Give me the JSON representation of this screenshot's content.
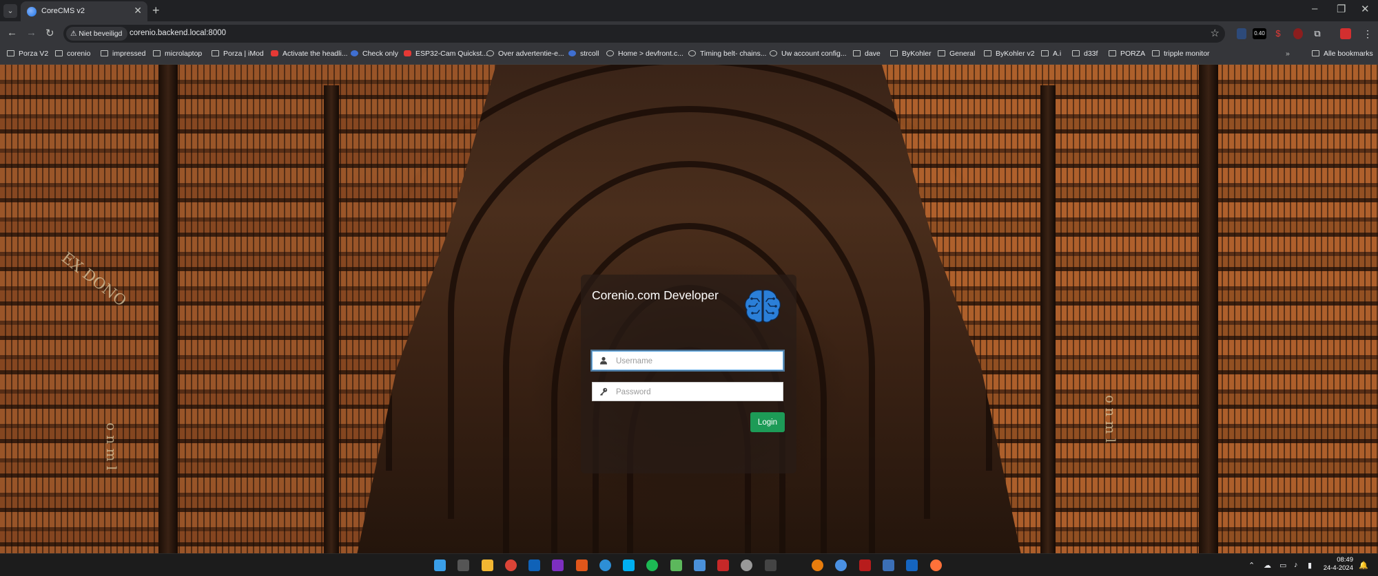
{
  "browser": {
    "tab": {
      "title": "CoreCMS v2"
    },
    "omnibox": {
      "security_label": "Niet beveiligd",
      "url": "corenio.backend.local:8000"
    },
    "extension_badge": "0.40",
    "bookmarks": [
      {
        "label": "Porza V2",
        "icon": "folder-icon"
      },
      {
        "label": "corenio",
        "icon": "folder-icon"
      },
      {
        "label": "impressed",
        "icon": "folder-icon"
      },
      {
        "label": "microlaptop",
        "icon": "folder-icon"
      },
      {
        "label": "Porza | iMod",
        "icon": "folder-icon"
      },
      {
        "label": "Activate the headli...",
        "icon": "youtube-icon"
      },
      {
        "label": "Check only",
        "icon": "globe-icon"
      },
      {
        "label": "ESP32-Cam Quickst...",
        "icon": "youtube-icon"
      },
      {
        "label": "Over advertentie-e...",
        "icon": "google-icon"
      },
      {
        "label": "strcoll",
        "icon": "php-icon"
      },
      {
        "label": "Home > devfront.c...",
        "icon": "site-icon"
      },
      {
        "label": "Timing belt- chains...",
        "icon": "site-icon"
      },
      {
        "label": "Uw account config...",
        "icon": "google-icon"
      },
      {
        "label": "dave",
        "icon": "folder-icon"
      },
      {
        "label": "ByKohler",
        "icon": "folder-icon"
      },
      {
        "label": "General",
        "icon": "folder-icon"
      },
      {
        "label": "ByKohler v2",
        "icon": "folder-icon"
      },
      {
        "label": "A.i",
        "icon": "folder-icon"
      },
      {
        "label": "d33f",
        "icon": "folder-icon"
      },
      {
        "label": "PORZA",
        "icon": "folder-icon"
      },
      {
        "label": "tripple monitor",
        "icon": "folder-icon"
      }
    ],
    "all_bookmarks_label": "Alle bookmarks"
  },
  "page": {
    "inscriptions": [
      "EX DONO",
      "o n m l",
      "o n m l"
    ],
    "login": {
      "brand": "Corenio.com Developer",
      "logo": "brain-icon",
      "username_placeholder": "Username",
      "password_placeholder": "Password",
      "submit_label": "Login",
      "accent_color": "#1d9b57",
      "logo_color": "#2b7fd8"
    }
  },
  "taskbar": {
    "clock_time": "08:49",
    "clock_date": "24-4-2024"
  }
}
